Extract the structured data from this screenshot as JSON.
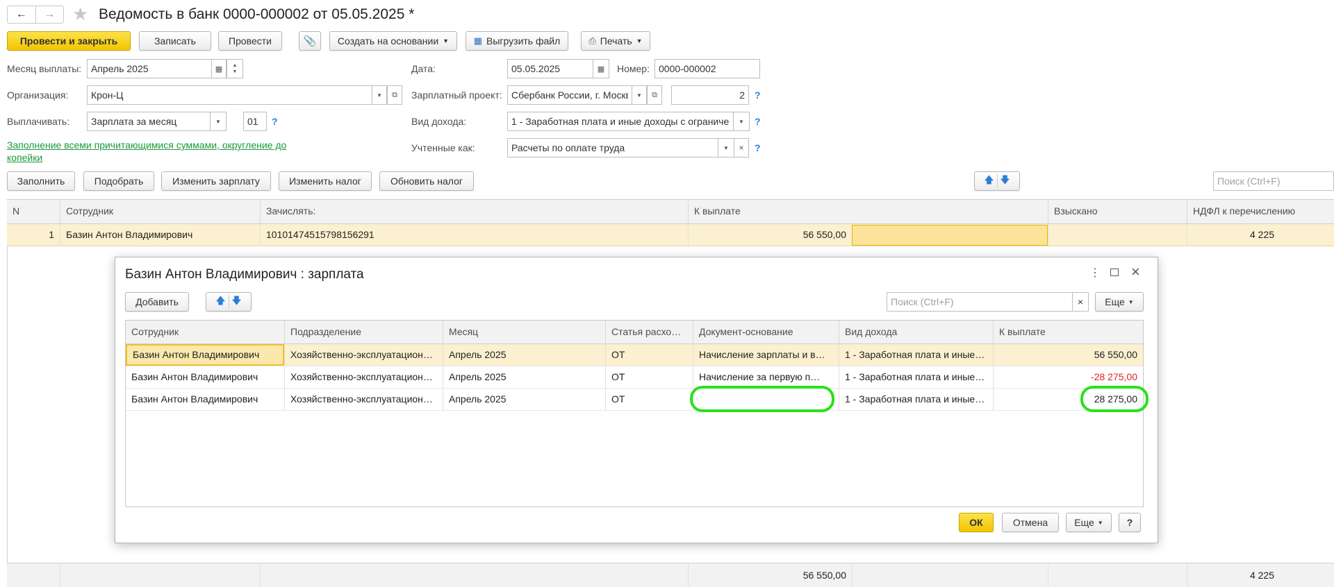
{
  "window": {
    "title": "Ведомость в банк 0000-000002 от 05.05.2025 *",
    "back_icon": "arrow-left-icon",
    "forward_icon": "arrow-right-icon",
    "favorite_icon": "star-icon"
  },
  "toolbar": {
    "post_close": "Провести и закрыть",
    "save": "Записать",
    "post": "Провести",
    "create_based": "Создать на основании",
    "export": "Выгрузить файл",
    "print": "Печать"
  },
  "form": {
    "month_label": "Месяц выплаты:",
    "month_value": "Апрель 2025",
    "date_label": "Дата:",
    "date_value": "05.05.2025",
    "number_label": "Номер:",
    "number_value": "0000-000002",
    "org_label": "Организация:",
    "org_value": "Крон-Ц",
    "project_label": "Зарплатный проект:",
    "project_value": "Сбербанк России, г. Москв",
    "project_count": "2",
    "pay_label": "Выплачивать:",
    "pay_value": "Зарплата за месяц",
    "pay_code": "01",
    "income_label": "Вид дохода:",
    "income_value": "1 - Заработная плата и иные доходы с ограничен",
    "accounted_label": "Учтенные как:",
    "accounted_value": "Расчеты по оплате труда",
    "fill_link": "Заполнение всеми причитающимися суммами, округление до копейки",
    "help": "?"
  },
  "actions": {
    "fill": "Заполнить",
    "pick": "Подобрать",
    "change_salary": "Изменить зарплату",
    "change_tax": "Изменить налог",
    "refresh_tax": "Обновить налог",
    "search_placeholder": "Поиск (Ctrl+F)"
  },
  "main_table": {
    "headers": [
      "N",
      "Сотрудник",
      "Зачислять:",
      "К выплате",
      "Взыскано",
      "НДФЛ к перечислению"
    ],
    "row": {
      "n": "1",
      "employee": "Базин Антон Владимирович",
      "account": "10101474515798156291",
      "to_pay": "56 550,00",
      "withheld": "",
      "ndfl": "4 225"
    },
    "footer": {
      "to_pay": "56 550,00",
      "ndfl": "4 225"
    }
  },
  "dialog": {
    "title": "Базин Антон Владимирович : зарплата",
    "add": "Добавить",
    "search_placeholder": "Поиск (Ctrl+F)",
    "more": "Еще",
    "ok": "ОК",
    "cancel": "Отмена",
    "help": "?",
    "headers": [
      "Сотрудник",
      "Подразделение",
      "Месяц",
      "Статья расхо…",
      "Документ-основание",
      "Вид дохода",
      "К выплате"
    ],
    "rows": [
      {
        "employee": "Базин Антон Владимирович",
        "department": "Хозяйственно-эксплуатацион…",
        "month": "Апрель 2025",
        "article": "ОТ",
        "document": "Начисление зарплаты и в…",
        "income": "1 - Заработная плата и иные …",
        "to_pay": "56 550,00"
      },
      {
        "employee": "Базин Антон Владимирович",
        "department": "Хозяйственно-эксплуатацион…",
        "month": "Апрель 2025",
        "article": "ОТ",
        "document": "Начисление за первую п…",
        "income": "1 - Заработная плата и иные …",
        "to_pay": "-28 275,00"
      },
      {
        "employee": "Базин Антон Владимирович",
        "department": "Хозяйственно-эксплуатацион…",
        "month": "Апрель 2025",
        "article": "ОТ",
        "document": "",
        "income": "1 - Заработная плата и иные …",
        "to_pay": "28 275,00"
      }
    ]
  },
  "colors": {
    "primary_button": "#f2c500",
    "selected_row": "#fbf0cf",
    "negative": "#e02020",
    "highlight_oval": "#29e21a",
    "help": "#2a7fd8",
    "link": "#1a9a3a"
  }
}
